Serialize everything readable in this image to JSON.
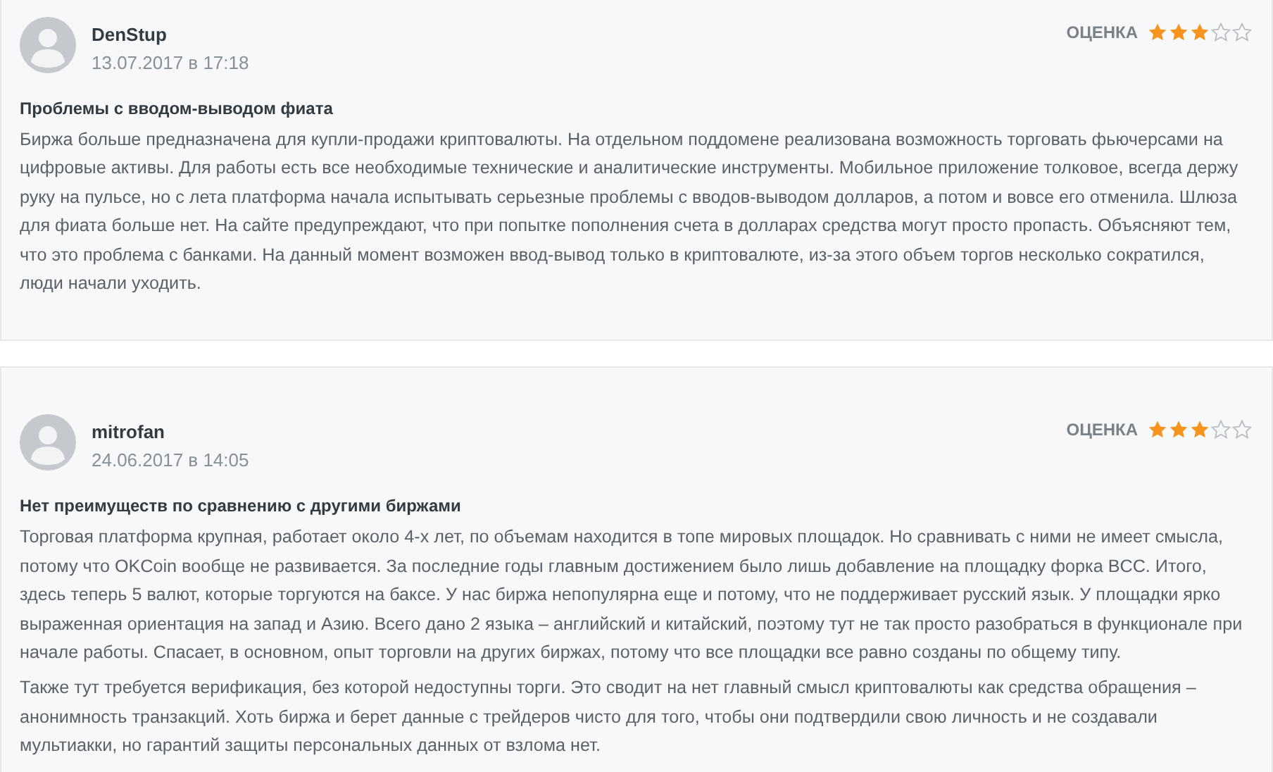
{
  "reviews": [
    {
      "author": "DenStup",
      "date": "13.07.2017 в 17:18",
      "rating_label": "ОЦЕНКА",
      "stars": 3,
      "title": "Проблемы с вводом-выводом фиата",
      "paragraphs": [
        "Биржа больше предназначена для купли-продажи криптовалюты. На отдельном поддомене реализована возможность торговать фьючерсами на цифровые активы. Для работы есть все необходимые технические и аналитические инструменты. Мобильное приложение толковое, всегда держу руку на пульсе, но с лета платформа начала испытывать серьезные проблемы с вводов-выводом долларов, а потом и вовсе его отменила. Шлюза для фиата больше нет. На сайте предупреждают, что при попытке пополнения счета в долларах средства могут просто пропасть. Объясняют тем, что это проблема с банками. На данный момент возможен ввод-вывод только в криптовалюте, из-за этого объем торгов несколько сократился, люди начали уходить."
      ]
    },
    {
      "author": "mitrofan",
      "date": "24.06.2017 в 14:05",
      "rating_label": "ОЦЕНКА",
      "stars": 3,
      "title": "Нет преимуществ по сравнению с другими биржами",
      "paragraphs": [
        "Торговая платформа крупная, работает около 4-х лет, по объемам находится в топе мировых площадок. Но сравнивать с ними не имеет смысла, потому что OKCoin вообще не развивается. За последние годы главным достижением было лишь добавление на площадку форка BCC. Итого, здесь теперь 5 валют, которые торгуются на баксе. У нас биржа непопулярна еще и потому, что не поддерживает русский язык. У площадки ярко выраженная ориентация на запад и Азию. Всего дано 2 языка – английский и китайский, поэтому тут не так просто разобраться в функционале при начале работы. Спасает, в основном, опыт торговли на других биржах, потому что все площадки все равно созданы по общему типу.",
        "Также тут требуется верификация, без которой недоступны торги. Это сводит на нет главный смысл криптовалюты как средства обращения – анонимность транзакций. Хоть биржа и берет данные с трейдеров чисто для того, чтобы они подтвердили свою личность и не создавали мультиакки, но гарантий защиты персональных данных от взлома нет."
      ]
    }
  ]
}
